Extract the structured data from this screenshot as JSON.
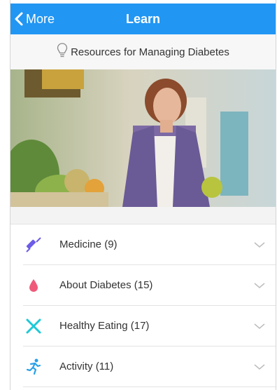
{
  "nav": {
    "back_label": "More",
    "title": "Learn",
    "bar_color": "#2196f3"
  },
  "section": {
    "title": "Resources for Managing Diabetes",
    "icon": "lightbulb-icon"
  },
  "hero": {
    "icon": "hero-photo"
  },
  "categories": [
    {
      "label": "Medicine",
      "count": "(9)",
      "icon": "syringe-icon",
      "color": "#6c5ce7"
    },
    {
      "label": "About Diabetes",
      "count": "(15)",
      "icon": "blood-drop-icon",
      "color": "#ef5a7a"
    },
    {
      "label": "Healthy Eating",
      "count": "(17)",
      "icon": "fork-knife-icon",
      "color": "#1ec8d8"
    },
    {
      "label": "Activity",
      "count": "(11)",
      "icon": "running-icon",
      "color": "#2aa0e8"
    }
  ]
}
